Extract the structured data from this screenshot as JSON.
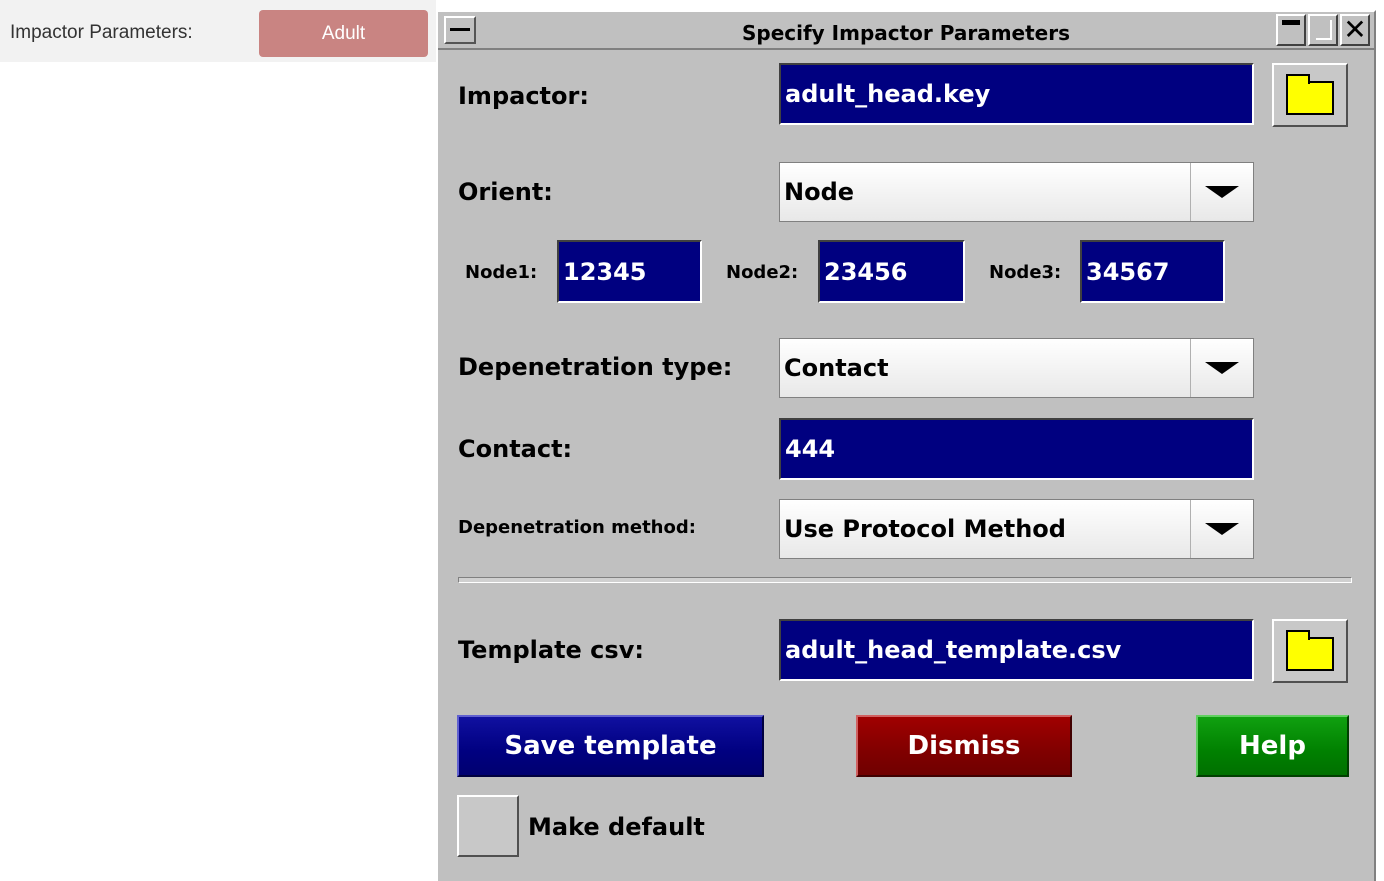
{
  "host": {
    "label": "Impactor Parameters:",
    "button_label": "Adult"
  },
  "dialog": {
    "title": "Specify Impactor Parameters",
    "close_glyph": "✕",
    "impactor": {
      "label": "Impactor:",
      "value": "adult_head.key"
    },
    "orient": {
      "label": "Orient:",
      "value": "Node"
    },
    "nodes": [
      {
        "label": "Node1:",
        "value": "12345"
      },
      {
        "label": "Node2:",
        "value": "23456"
      },
      {
        "label": "Node3:",
        "value": "34567"
      }
    ],
    "depenetration_type": {
      "label": "Depenetration type:",
      "value": "Contact"
    },
    "contact": {
      "label": "Contact:",
      "value": "444"
    },
    "depenetration_method": {
      "label": "Depenetration method:",
      "value": "Use Protocol Method"
    },
    "template_csv": {
      "label": "Template csv:",
      "value": "adult_head_template.csv"
    },
    "buttons": {
      "save": "Save template",
      "dismiss": "Dismiss",
      "help": "Help"
    },
    "make_default": {
      "label": "Make default",
      "checked": false
    }
  },
  "colors": {
    "field_bg": "#000080",
    "dialog_bg": "#c0c0c0",
    "host_button": "#c98482",
    "folder_icon": "#ffff00",
    "save_button": "#000080",
    "dismiss_button": "#800000",
    "help_button": "#008000"
  },
  "icons": {
    "folder": "folder-icon",
    "dropdown": "chevron-down-icon"
  }
}
